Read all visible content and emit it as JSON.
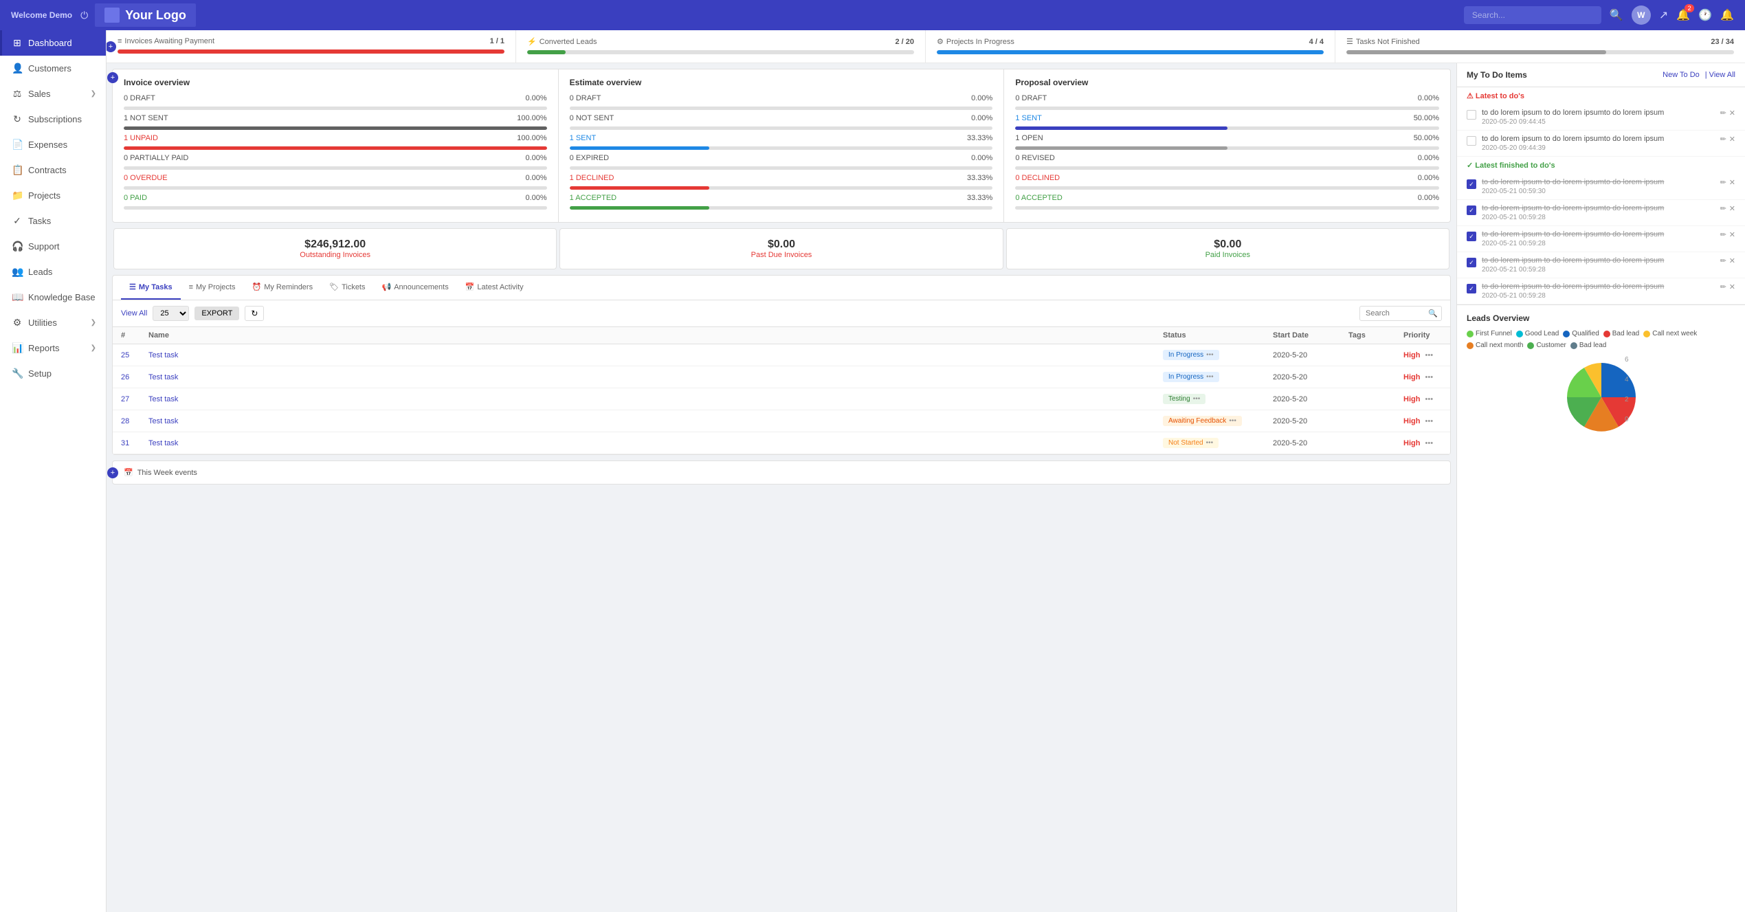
{
  "header": {
    "welcome": "Welcome Demo",
    "logo_text": "Your Logo",
    "search_placeholder": "Search...",
    "icons": {
      "search": "🔍",
      "avatar": "W",
      "share": "↗",
      "notifications": "🔔",
      "notification_count": "2",
      "bell": "🔔",
      "clock": "🕐"
    }
  },
  "sidebar": {
    "items": [
      {
        "id": "dashboard",
        "label": "Dashboard",
        "icon": "⊞",
        "active": true
      },
      {
        "id": "customers",
        "label": "Customers",
        "icon": "👤"
      },
      {
        "id": "sales",
        "label": "Sales",
        "icon": "⚖",
        "has_arrow": true
      },
      {
        "id": "subscriptions",
        "label": "Subscriptions",
        "icon": "↻"
      },
      {
        "id": "expenses",
        "label": "Expenses",
        "icon": "📄"
      },
      {
        "id": "contracts",
        "label": "Contracts",
        "icon": "📋"
      },
      {
        "id": "projects",
        "label": "Projects",
        "icon": "📁"
      },
      {
        "id": "tasks",
        "label": "Tasks",
        "icon": "✓"
      },
      {
        "id": "support",
        "label": "Support",
        "icon": "🎧"
      },
      {
        "id": "leads",
        "label": "Leads",
        "icon": "👥"
      },
      {
        "id": "knowledge-base",
        "label": "Knowledge Base",
        "icon": "📖"
      },
      {
        "id": "utilities",
        "label": "Utilities",
        "icon": "⚙",
        "has_arrow": true
      },
      {
        "id": "reports",
        "label": "Reports",
        "icon": "📊",
        "has_arrow": true
      },
      {
        "id": "setup",
        "label": "Setup",
        "icon": "🔧"
      }
    ]
  },
  "stat_cards": [
    {
      "id": "invoices-awaiting",
      "title": "Invoices Awaiting Payment",
      "value": "1 / 1",
      "progress": 100,
      "color": "#e53935",
      "icon": "≡"
    },
    {
      "id": "converted-leads",
      "title": "Converted Leads",
      "value": "2 / 20",
      "progress": 10,
      "color": "#43a047",
      "icon": "⚡"
    },
    {
      "id": "projects-inprogress",
      "title": "Projects In Progress",
      "value": "4 / 4",
      "progress": 100,
      "color": "#1e88e5",
      "icon": "⚙"
    },
    {
      "id": "tasks-not-finished",
      "title": "Tasks Not Finished",
      "value": "23 / 34",
      "progress": 67,
      "color": "#9e9e9e",
      "icon": "☰"
    }
  ],
  "invoice_overview": {
    "title": "Invoice overview",
    "rows": [
      {
        "label": "0 DRAFT",
        "value": "0.00%",
        "color": "#9e9e9e",
        "pct": 0,
        "class": ""
      },
      {
        "label": "1 NOT SENT",
        "value": "100.00%",
        "color": "#616161",
        "pct": 100,
        "class": ""
      },
      {
        "label": "1 UNPAID",
        "value": "100.00%",
        "color": "#e53935",
        "pct": 100,
        "class": "red"
      },
      {
        "label": "0 PARTIALLY PAID",
        "value": "0.00%",
        "color": "#9e9e9e",
        "pct": 0,
        "class": ""
      },
      {
        "label": "0 OVERDUE",
        "value": "0.00%",
        "color": "#e53935",
        "pct": 0,
        "class": "red"
      },
      {
        "label": "0 PAID",
        "value": "0.00%",
        "color": "#43a047",
        "pct": 0,
        "class": "green"
      }
    ],
    "summary": {
      "amount": "$246,912.00",
      "label": "Outstanding Invoices"
    }
  },
  "estimate_overview": {
    "title": "Estimate overview",
    "rows": [
      {
        "label": "0 DRAFT",
        "value": "0.00%",
        "color": "#9e9e9e",
        "pct": 0,
        "class": ""
      },
      {
        "label": "0 NOT SENT",
        "value": "0.00%",
        "color": "#9e9e9e",
        "pct": 0,
        "class": ""
      },
      {
        "label": "1 SENT",
        "value": "33.33%",
        "color": "#1e88e5",
        "pct": 33,
        "class": "blue"
      },
      {
        "label": "0 EXPIRED",
        "value": "0.00%",
        "color": "#9e9e9e",
        "pct": 0,
        "class": ""
      },
      {
        "label": "1 DECLINED",
        "value": "33.33%",
        "color": "#e53935",
        "pct": 33,
        "class": "red"
      },
      {
        "label": "1 ACCEPTED",
        "value": "33.33%",
        "color": "#43a047",
        "pct": 33,
        "class": "green"
      }
    ],
    "summary": {
      "amount": "$0.00",
      "label": "Past Due Invoices"
    }
  },
  "proposal_overview": {
    "title": "Proposal overview",
    "rows": [
      {
        "label": "0 DRAFT",
        "value": "0.00%",
        "color": "#9e9e9e",
        "pct": 0,
        "class": ""
      },
      {
        "label": "1 SENT",
        "value": "50.00%",
        "color": "#3a3fbf",
        "pct": 50,
        "class": "blue"
      },
      {
        "label": "1 OPEN",
        "value": "50.00%",
        "color": "#9e9e9e",
        "pct": 50,
        "class": ""
      },
      {
        "label": "0 REVISED",
        "value": "0.00%",
        "color": "#9e9e9e",
        "pct": 0,
        "class": ""
      },
      {
        "label": "0 DECLINED",
        "value": "0.00%",
        "color": "#e53935",
        "pct": 0,
        "class": "red"
      },
      {
        "label": "0 ACCEPTED",
        "value": "0.00%",
        "color": "#43a047",
        "pct": 0,
        "class": "green"
      }
    ],
    "summary": {
      "amount": "$0.00",
      "label": "Paid Invoices",
      "label_class": "green"
    }
  },
  "tabs": [
    {
      "id": "my-tasks",
      "label": "My Tasks",
      "icon": "☰",
      "active": true
    },
    {
      "id": "my-projects",
      "label": "My Projects",
      "icon": "≡"
    },
    {
      "id": "my-reminders",
      "label": "My Reminders",
      "icon": "⏰"
    },
    {
      "id": "tickets",
      "label": "Tickets",
      "icon": "🏷"
    },
    {
      "id": "announcements",
      "label": "Announcements",
      "icon": "📢"
    },
    {
      "id": "latest-activity",
      "label": "Latest Activity",
      "icon": "📅"
    }
  ],
  "tasks_table": {
    "columns": [
      "#",
      "Name",
      "Status",
      "Start Date",
      "Tags",
      "Priority"
    ],
    "view_all": "View All",
    "per_page": "25",
    "export_btn": "EXPORT",
    "search_placeholder": "Search",
    "rows": [
      {
        "id": "25",
        "name": "Test task",
        "status": "In Progress",
        "status_class": "status-inprogress",
        "start_date": "2020-5-20",
        "tags": "",
        "priority": "High"
      },
      {
        "id": "26",
        "name": "Test task",
        "status": "In Progress",
        "status_class": "status-inprogress",
        "start_date": "2020-5-20",
        "tags": "",
        "priority": "High"
      },
      {
        "id": "27",
        "name": "Test task",
        "status": "Testing",
        "status_class": "status-testing",
        "start_date": "2020-5-20",
        "tags": "",
        "priority": "High"
      },
      {
        "id": "28",
        "name": "Test task",
        "status": "Awaiting Feedback",
        "status_class": "status-awaiting",
        "start_date": "2020-5-20",
        "tags": "",
        "priority": "High"
      },
      {
        "id": "31",
        "name": "Test task",
        "status": "Not Started",
        "status_class": "status-notstarted",
        "start_date": "2020-5-20",
        "tags": "",
        "priority": "High"
      }
    ]
  },
  "week_events": {
    "title": "This Week events"
  },
  "todo": {
    "title": "My To Do Items",
    "new_link": "New To Do",
    "view_all": "| View All",
    "latest_todos_label": "⚠ Latest to do's",
    "latest_finished_label": "✓ Latest finished to do's",
    "unchecked_items": [
      {
        "text": "to do lorem ipsum to do lorem ipsumto do lorem ipsum",
        "date": "2020-05-20 09:44:45",
        "checked": false
      },
      {
        "text": "to do lorem ipsum to do lorem ipsumto do lorem ipsum",
        "date": "2020-05-20 09:44:39",
        "checked": false
      }
    ],
    "checked_items": [
      {
        "text": "to do lorem ipsum to do lorem ipsumto do lorem ipsum",
        "date": "2020-05-21 00:59:30",
        "checked": true
      },
      {
        "text": "to do lorem ipsum to do lorem ipsumto do lorem ipsum",
        "date": "2020-05-21 00:59:28",
        "checked": true
      },
      {
        "text": "to do lorem ipsum to do lorem ipsumto do lorem ipsum",
        "date": "2020-05-21 00:59:28",
        "checked": true
      },
      {
        "text": "to do lorem ipsum to do lorem ipsumto do lorem ipsum",
        "date": "2020-05-21 00:59:28",
        "checked": true
      },
      {
        "text": "to do lorem ipsum to do lorem ipsumto do lorem ipsum",
        "date": "2020-05-21 00:59:28",
        "checked": true
      }
    ]
  },
  "leads_overview": {
    "title": "Leads Overview",
    "legend": [
      {
        "label": "First Funnel",
        "color": "#69d04b"
      },
      {
        "label": "Good Lead",
        "color": "#00bcd4"
      },
      {
        "label": "Qualified",
        "color": "#1565c0"
      },
      {
        "label": "Bad lead",
        "color": "#e53935"
      },
      {
        "label": "Call next week",
        "color": "#fbc02d"
      },
      {
        "label": "Call next month",
        "color": "#e67e22"
      },
      {
        "label": "Customer",
        "color": "#4caf50"
      },
      {
        "label": "Bad lead",
        "color": "#607d8b"
      }
    ],
    "chart_labels": [
      "6",
      "4",
      "2",
      "0"
    ]
  }
}
